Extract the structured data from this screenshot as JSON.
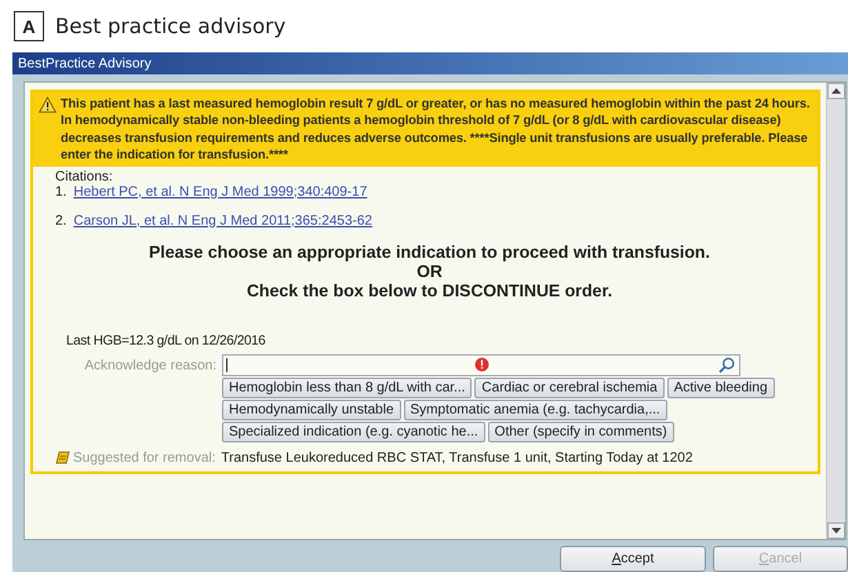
{
  "figure_label": "A",
  "figure_title": "Best practice advisory",
  "window": {
    "title": "BestPractice Advisory"
  },
  "alert": {
    "text": "This patient has a last measured hemoglobin result 7 g/dL or greater, or has no measured hemoglobin within the past 24 hours. In hemodynamically stable non-bleeding patients a hemoglobin threshold of 7 g/dL (or 8 g/dL with cardiovascular disease) decreases transfusion requirements and reduces adverse outcomes. ****Single unit transfusions are usually preferable. Please enter the indication for transfusion.****"
  },
  "citations": {
    "heading": "Citations:",
    "items": [
      {
        "number": "1.",
        "link": "Hebert PC, et al. N Eng J Med 1999;340:409-17"
      },
      {
        "number": "2.",
        "link": "Carson JL, et al. N Eng J Med 2011;365:2453-62"
      }
    ]
  },
  "instruction": [
    "Please choose an appropriate indication to proceed with transfusion.",
    "OR",
    "Check the box below to DISCONTINUE order."
  ],
  "last_hgb": "Last HGB=12.3 g/dL on 12/26/2016",
  "acknowledge": {
    "label": "Acknowledge reason:",
    "required": true,
    "options": [
      [
        "Hemoglobin less than 8 g/dL with car...",
        "Cardiac or cerebral ischemia",
        "Active bleeding"
      ],
      [
        "Hemodynamically unstable",
        "Symptomatic anemia (e.g. tachycardia,..."
      ],
      [
        "Specialized indication (e.g. cyanotic he...",
        "Other (specify in comments)"
      ]
    ]
  },
  "removal": {
    "label": "Suggested for removal:",
    "order": "Transfuse Leukoreduced RBC STAT, Transfuse 1 unit, Starting Today at 1202"
  },
  "buttons": [
    {
      "label": "Accept",
      "disabled": false
    },
    {
      "label": "Cancel",
      "disabled": true
    }
  ]
}
